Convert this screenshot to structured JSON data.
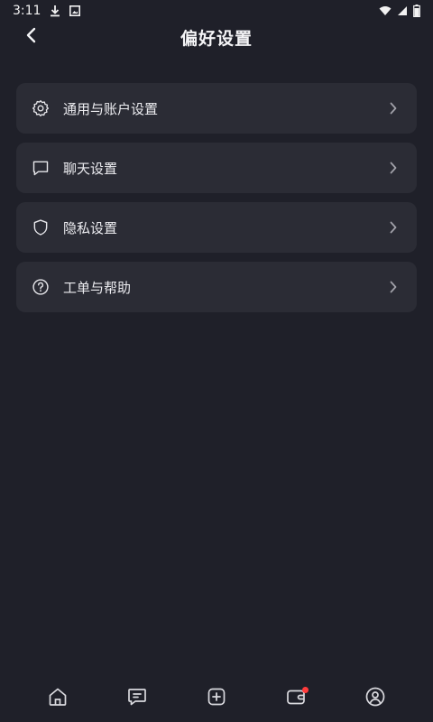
{
  "status_bar": {
    "time": "3:11",
    "icons": [
      "download-icon",
      "image-icon",
      "wifi-icon",
      "signal-icon",
      "battery-icon"
    ]
  },
  "header": {
    "title": "偏好设置",
    "back_icon": "chevron-left-icon"
  },
  "menu": {
    "items": [
      {
        "label": "通用与账户设置",
        "icon": "gear-icon"
      },
      {
        "label": "聊天设置",
        "icon": "chat-icon"
      },
      {
        "label": "隐私设置",
        "icon": "shield-icon"
      },
      {
        "label": "工单与帮助",
        "icon": "help-icon"
      }
    ]
  },
  "tab_bar": {
    "tabs": [
      {
        "name": "home",
        "icon": "home-icon"
      },
      {
        "name": "messages",
        "icon": "message-icon"
      },
      {
        "name": "create",
        "icon": "add-icon"
      },
      {
        "name": "wallet",
        "icon": "wallet-icon",
        "badge": true
      },
      {
        "name": "profile",
        "icon": "user-icon"
      }
    ],
    "badge_color": "#ff3b3b"
  },
  "colors": {
    "background": "#1f2029",
    "card": "#2b2c35",
    "text": "#ececf0"
  }
}
